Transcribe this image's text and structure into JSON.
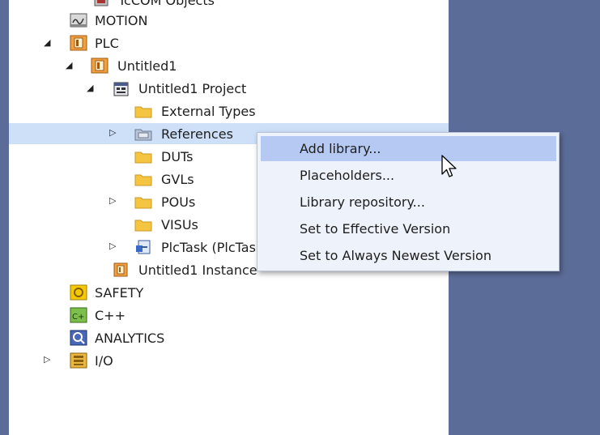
{
  "tree": {
    "items": [
      {
        "label": "TcCOM Objects",
        "icon": "tccom-icon"
      },
      {
        "label": "MOTION",
        "icon": "motion-icon"
      },
      {
        "label": "PLC",
        "icon": "plc-icon"
      },
      {
        "label": "Untitled1",
        "icon": "plc-project-icon"
      },
      {
        "label": "Untitled1 Project",
        "icon": "project-icon"
      },
      {
        "label": "External Types",
        "icon": "folder-icon"
      },
      {
        "label": "References",
        "icon": "references-icon"
      },
      {
        "label": "DUTs",
        "icon": "folder-icon"
      },
      {
        "label": "GVLs",
        "icon": "folder-icon"
      },
      {
        "label": "POUs",
        "icon": "folder-icon"
      },
      {
        "label": "VISUs",
        "icon": "folder-icon"
      },
      {
        "label": "PlcTask (PlcTask",
        "icon": "task-icon"
      },
      {
        "label": "Untitled1 Instance",
        "icon": "instance-icon"
      },
      {
        "label": "SAFETY",
        "icon": "safety-icon"
      },
      {
        "label": "C++",
        "icon": "cpp-icon"
      },
      {
        "label": "ANALYTICS",
        "icon": "analytics-icon"
      },
      {
        "label": "I/O",
        "icon": "io-icon"
      }
    ]
  },
  "context_menu": {
    "items": [
      {
        "label": "Add library..."
      },
      {
        "label": "Placeholders..."
      },
      {
        "label": "Library repository..."
      },
      {
        "label": "Set to Effective Version"
      },
      {
        "label": "Set to Always Newest Version"
      }
    ]
  },
  "colors": {
    "background": "#5b6c98",
    "selection": "#cde0f7",
    "menu_highlight": "#b5c9f2"
  }
}
